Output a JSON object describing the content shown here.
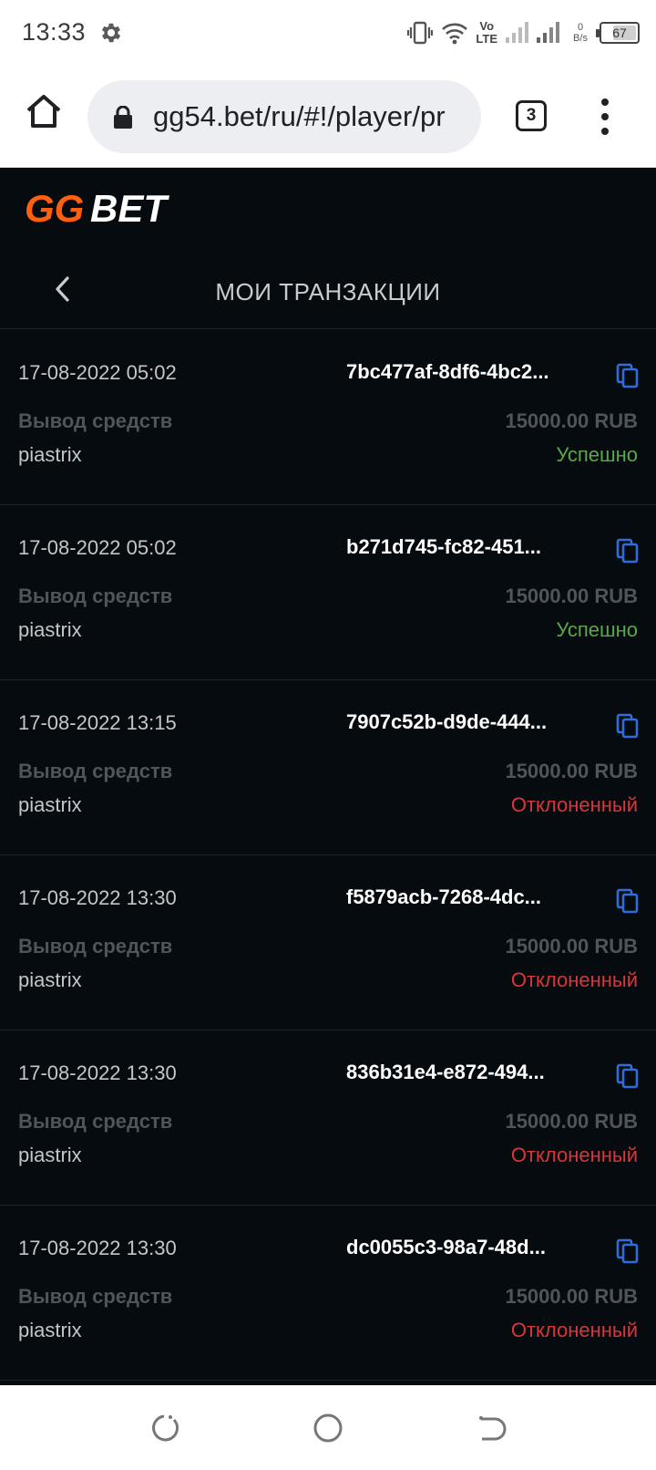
{
  "status_bar": {
    "time": "13:33",
    "speed_value": "0",
    "speed_unit": "B/s",
    "battery": "67",
    "battery_level": 0.67,
    "network_label_top": "Vo",
    "network_label_bottom": "LTE"
  },
  "browser": {
    "url": "gg54.bet/ru/#!/player/pr",
    "tab_count": "3"
  },
  "app": {
    "logo_text_left": "GG",
    "logo_text_right": "BET",
    "title": "МОИ ТРАНЗАКЦИИ",
    "colors": {
      "background": "#050b0f",
      "logo_orange": "#ff5f0f",
      "success": "#5aa84a",
      "rejected": "#d9363a",
      "copy_icon": "#2f6ddb"
    }
  },
  "transactions": [
    {
      "date": "17-08-2022 05:02",
      "id": "7bc477af-8df6-4bc2...",
      "type": "Вывод средств",
      "amount": "15000.00 RUB",
      "method": "piastrix",
      "status": "Успешно",
      "status_kind": "success"
    },
    {
      "date": "17-08-2022 05:02",
      "id": "b271d745-fc82-451...",
      "type": "Вывод средств",
      "amount": "15000.00 RUB",
      "method": "piastrix",
      "status": "Успешно",
      "status_kind": "success"
    },
    {
      "date": "17-08-2022 13:15",
      "id": "7907c52b-d9de-444...",
      "type": "Вывод средств",
      "amount": "15000.00 RUB",
      "method": "piastrix",
      "status": "Отклоненный",
      "status_kind": "rejected"
    },
    {
      "date": "17-08-2022 13:30",
      "id": "f5879acb-7268-4dc...",
      "type": "Вывод средств",
      "amount": "15000.00 RUB",
      "method": "piastrix",
      "status": "Отклоненный",
      "status_kind": "rejected"
    },
    {
      "date": "17-08-2022 13:30",
      "id": "836b31e4-e872-494...",
      "type": "Вывод средств",
      "amount": "15000.00 RUB",
      "method": "piastrix",
      "status": "Отклоненный",
      "status_kind": "rejected"
    },
    {
      "date": "17-08-2022 13:30",
      "id": "dc0055c3-98a7-48d...",
      "type": "Вывод средств",
      "amount": "15000.00 RUB",
      "method": "piastrix",
      "status": "Отклоненный",
      "status_kind": "rejected"
    }
  ],
  "icons": {
    "status_bar": [
      "settings-gear-icon",
      "vibrate-icon",
      "wifi-icon",
      "signal-icon",
      "battery-icon"
    ],
    "browser": [
      "home-icon",
      "lock-icon",
      "tabs-icon",
      "more-vert-icon"
    ],
    "app": [
      "back-chevron-icon",
      "copy-icon"
    ],
    "nav": [
      "recent-apps-icon",
      "home-circle-icon",
      "back-icon"
    ]
  }
}
